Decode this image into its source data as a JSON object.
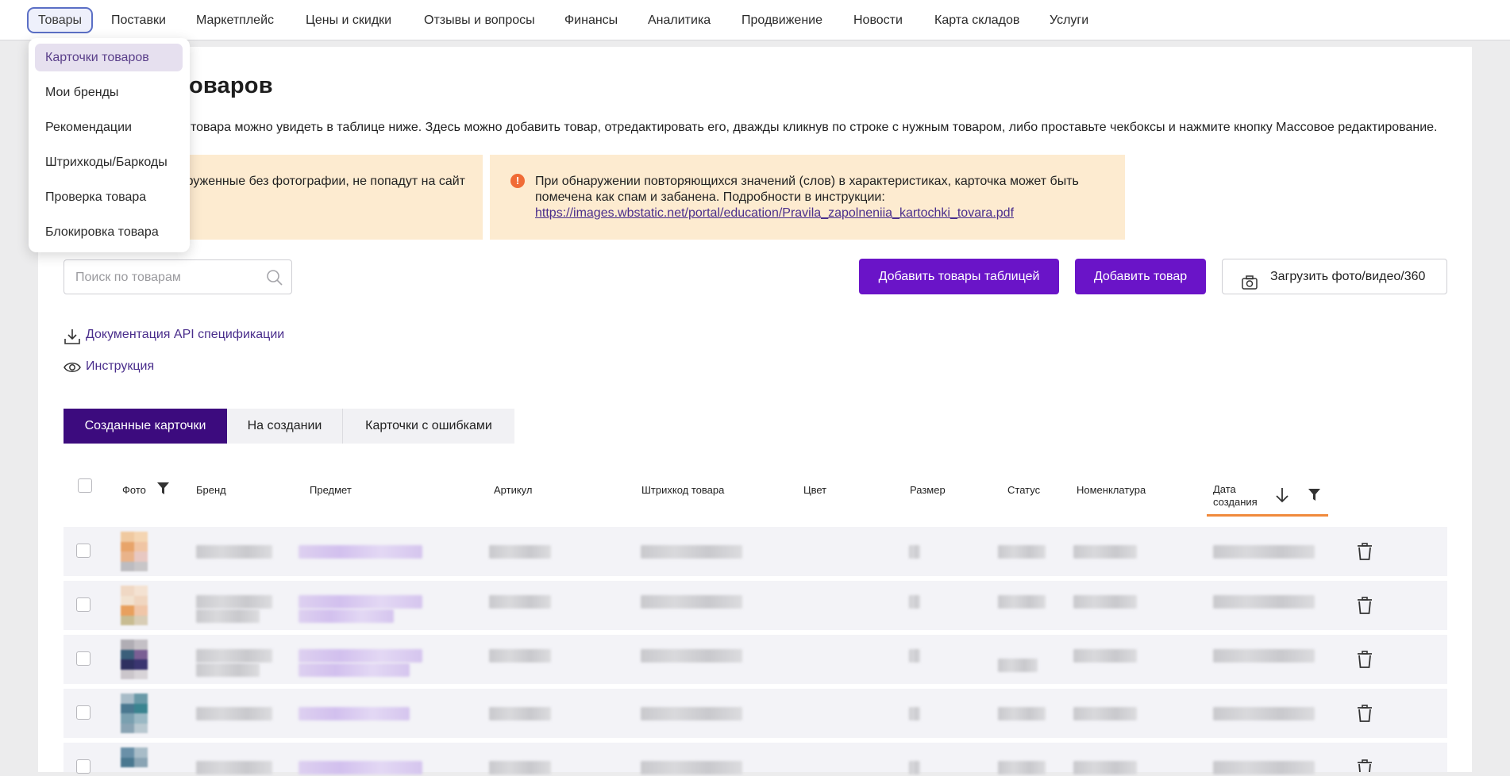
{
  "nav": {
    "items": [
      "Товары",
      "Поставки",
      "Маркетплейс",
      "Цены и скидки",
      "Отзывы и вопросы",
      "Финансы",
      "Аналитика",
      "Продвижение",
      "Новости",
      "Карта складов",
      "Услуги"
    ]
  },
  "dropdown": {
    "items": [
      "Карточки товаров",
      "Мои бренды",
      "Рекомендации",
      "Штрихкоды/Баркоды",
      "Проверка товара",
      "Блокировка товара"
    ]
  },
  "page": {
    "title_fragment": "оваров",
    "description_fragment": "товара можно увидеть в таблице ниже. Здесь можно добавить товар, отредактировать его, дважды кликнув по строке с нужным товаром, либо проставьте чекбоксы и нажмите кнопку Массовое редактирование."
  },
  "alerts": {
    "left_fragment_line1": "руженные без фотографии, не попадут на сайт",
    "right_line1": "При обнаружении повторяющихся значений (слов) в характеристиках, карточка может быть",
    "right_line2": "помечена как спам и забанена. Подробности в инструкции:",
    "right_link": "https://images.wbstatic.net/portal/education/Pravila_zapolneniia_kartochki_tovara.pdf",
    "warn_glyph": "!"
  },
  "search": {
    "placeholder": "Поиск по товарам"
  },
  "buttons": {
    "add_table": "Добавить товары таблицей",
    "add_item": "Добавить товар",
    "upload": "Загрузить фото/видео/360"
  },
  "links": {
    "api_docs": "Документация API спецификации",
    "instruction": "Инструкция"
  },
  "tabs": [
    "Созданные карточки",
    "На создании",
    "Карточки с ошибками"
  ],
  "table": {
    "headers": {
      "photo": "Фото",
      "brand": "Бренд",
      "subject": "Предмет",
      "article": "Артикул",
      "barcode": "Штрихкод товара",
      "color": "Цвет",
      "size": "Размер",
      "status": "Статус",
      "nomenclature": "Номенклатура",
      "created_line1": "Дата",
      "created_line2": "создания"
    },
    "row_count_visible": 5
  },
  "colors": {
    "primary": "#6a14c8",
    "tab_active": "#3c0b7e",
    "alert_bg": "#fdebd0",
    "sort_accent": "#f08a3c",
    "warn": "#f06b36"
  }
}
